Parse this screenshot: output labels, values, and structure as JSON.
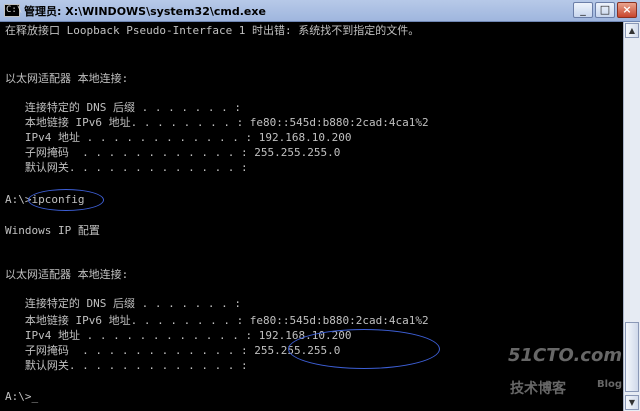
{
  "window": {
    "title": "管理员: X:\\WINDOWS\\system32\\cmd.exe",
    "icon_text": "C:\\",
    "buttons": {
      "minimize": "_",
      "maximize": "□",
      "close": "×"
    }
  },
  "console": {
    "lines": [
      "在释放接口 Loopback Pseudo-Interface 1 时出错: 系统找不到指定的文件。",
      "",
      "",
      "以太网适配器 本地连接:",
      "",
      "   连接特定的 DNS 后缀 . . . . . . . :",
      "   本地链接 IPv6 地址. . . . . . . . : fe80::545d:b880:2cad:4ca1%2",
      "   IPv4 地址 . . . . . . . . . . . . : 192.168.10.200",
      "   子网掩码  . . . . . . . . . . . . : 255.255.255.0",
      "   默认网关. . . . . . . . . . . . . :",
      "",
      "A:\\>ipconfig",
      "",
      "Windows IP 配置",
      "",
      "",
      "以太网适配器 本地连接:",
      "",
      "   连接特定的 DNS 后缀 . . . . . . . :",
      "   本地链接 IPv6 地址. . . . . . . . : fe80::545d:b880:2cad:4ca1%2",
      "   IPv4 地址 . . . . . . . . . . . . : 192.168.10.200",
      "   子网掩码  . . . . . . . . . . . . : 255.255.255.0",
      "   默认网关. . . . . . . . . . . . . :",
      "",
      "A:\\>_"
    ]
  },
  "scrollbar": {
    "up_arrow": "▲",
    "down_arrow": "▼"
  },
  "watermark": {
    "main": "51CTO.com",
    "sub": "技术博客",
    "blog": "Blog"
  },
  "colors": {
    "text": "#c0c0c0",
    "background": "#000000",
    "annotation": "#3d5fd6"
  }
}
